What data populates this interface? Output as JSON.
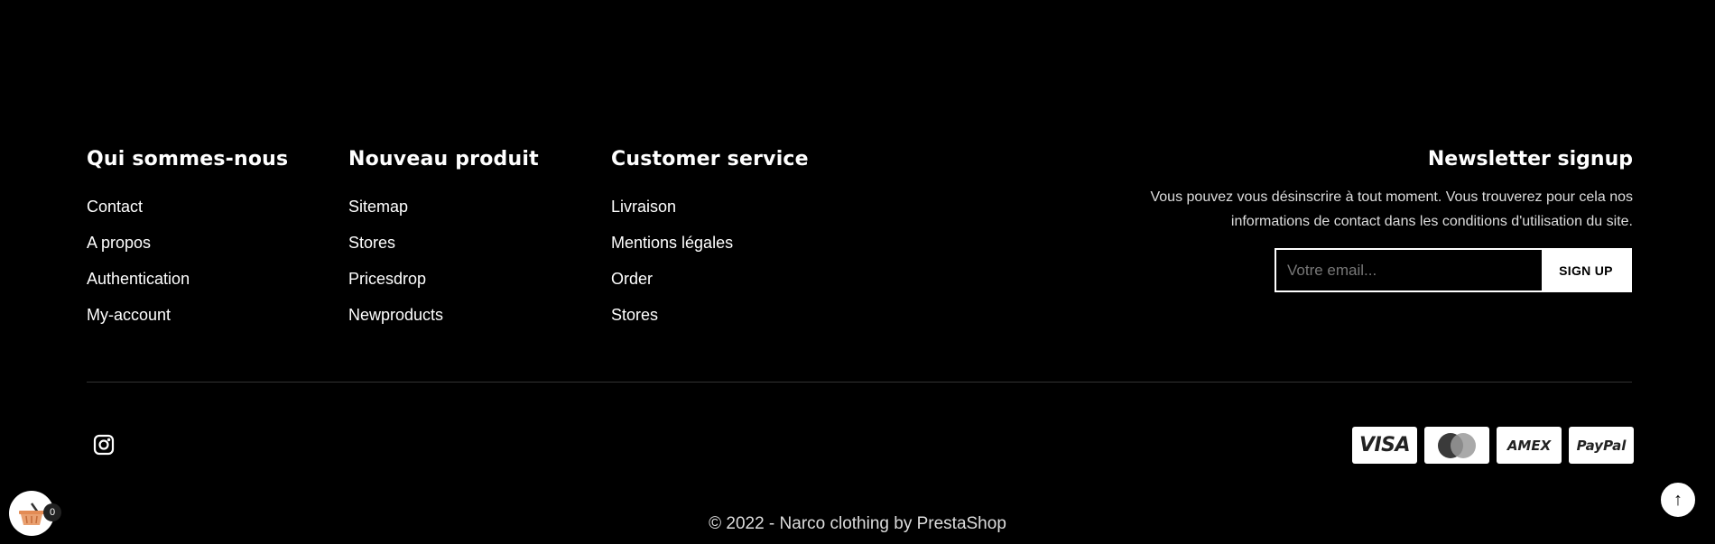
{
  "columns": [
    {
      "title": "Qui sommes-nous",
      "links": [
        "Contact",
        "A propos",
        "Authentication",
        "My-account"
      ]
    },
    {
      "title": "Nouveau produit",
      "links": [
        "Sitemap",
        "Stores",
        "Pricesdrop",
        "Newproducts"
      ]
    },
    {
      "title": "Customer service",
      "links": [
        "Livraison",
        "Mentions légales",
        "Order",
        "Stores"
      ]
    }
  ],
  "newsletter": {
    "title": "Newsletter signup",
    "description": "Vous pouvez vous désinscrire à tout moment. Vous trouverez pour cela nos informations de contact dans les conditions d'utilisation du site.",
    "placeholder": "Votre email...",
    "button": "SIGN UP"
  },
  "social": {
    "icon": "instagram-icon"
  },
  "payments": [
    "VISA",
    "mastercard",
    "AMEX",
    "PayPal"
  ],
  "copyright": "© 2022 - Narco clothing by PrestaShop",
  "cart": {
    "count": "0",
    "icon": "basket-icon"
  },
  "scroll_top": {
    "icon": "arrow-up-icon",
    "label": "↑"
  }
}
